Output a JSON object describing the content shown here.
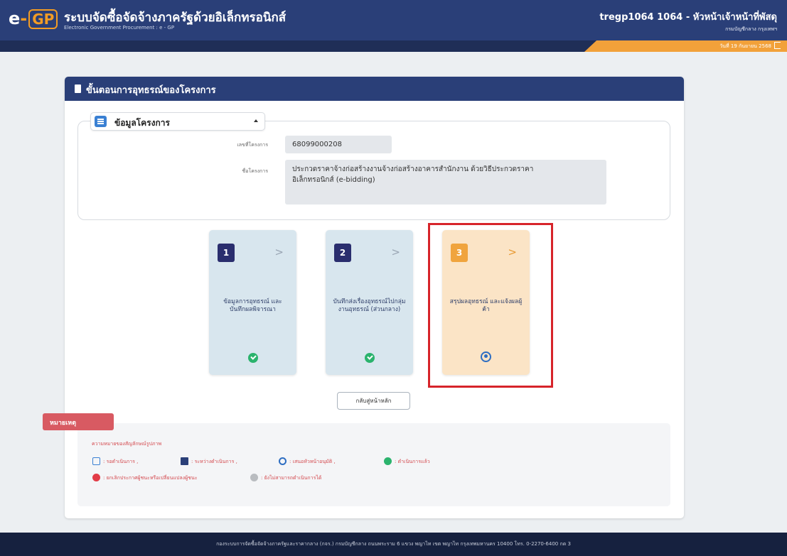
{
  "header": {
    "logo_e": "e",
    "logo_dash": "-",
    "logo_gp": "GP",
    "title": "ระบบจัดซื้อจัดจ้างภาครัฐด้วยอิเล็กทรอนิกส์",
    "subtitle": "Electronic Government Procurement : e - GP",
    "user": "tregp1064 1064 - หัวหน้าเจ้าหน้าที่พัสดุ",
    "org": "กรมบัญชีกลาง กรุงเทพฯ",
    "date": "วันที่ 19 กันยายน 2568"
  },
  "card": {
    "title": "ขั้นตอนการอุทธรณ์ของโครงการ",
    "section_title": "ข้อมูลโครงการ",
    "project_no_label": "เลขที่โครงการ",
    "project_no": "68099000208",
    "project_name_label": "ชื่อโครงการ",
    "project_name_line1": "ประกวดราคาจ้างก่อสร้างงานจ้างก่อสร้างอาคารสำนักงาน ด้วยวิธีประกวดราคา",
    "project_name_line2": "อิเล็กทรอนิกส์ (e-bidding)"
  },
  "steps": [
    {
      "num": "1",
      "chevron": ">",
      "label": "ข้อมูลการอุทธรณ์ และบันทึกผลพิจารณา",
      "status": "done"
    },
    {
      "num": "2",
      "chevron": ">",
      "label": "บันทึกส่งเรื่องอุทธรณ์ไปกลุ่มงานอุทธรณ์ (ส่วนกลาง)",
      "status": "done"
    },
    {
      "num": "3",
      "chevron": ">",
      "label": "สรุปผลอุทธรณ์ และแจ้งผลผู้ค้า",
      "status": "current"
    }
  ],
  "back_button": "กลับสู่หน้าหลัก",
  "notes": {
    "ribbon": "หมายเหตุ",
    "heading": "ความหมายของสัญลักษณ์รูปภาพ",
    "legend_row1": [
      ": รอดำเนินการ ,",
      ": ระหว่างดำเนินการ ,",
      ": เสนอหัวหน้าอนุมัติ ,",
      ": ดำเนินการแล้ว"
    ],
    "legend_row2": [
      ": ยกเลิกประกาศผู้ชนะหรือเปลี่ยนแปลงผู้ชนะ",
      ": ยังไม่สามารถดำเนินการได้"
    ]
  },
  "footer": "กองระบบการจัดซื้อจัดจ้างภาครัฐและราคากลาง (กจร.) กรมบัญชีกลาง ถนนพระราม 6 แขวง พญาไท เขต พญาไท กรุงเทพมหานคร 10400 โทร. 0-2270-6400 กด 3",
  "colors": {
    "navy": "#2a3f78",
    "orange": "#f39c24",
    "done_green": "#2bb36d",
    "highlight_red": "#d7242a"
  }
}
